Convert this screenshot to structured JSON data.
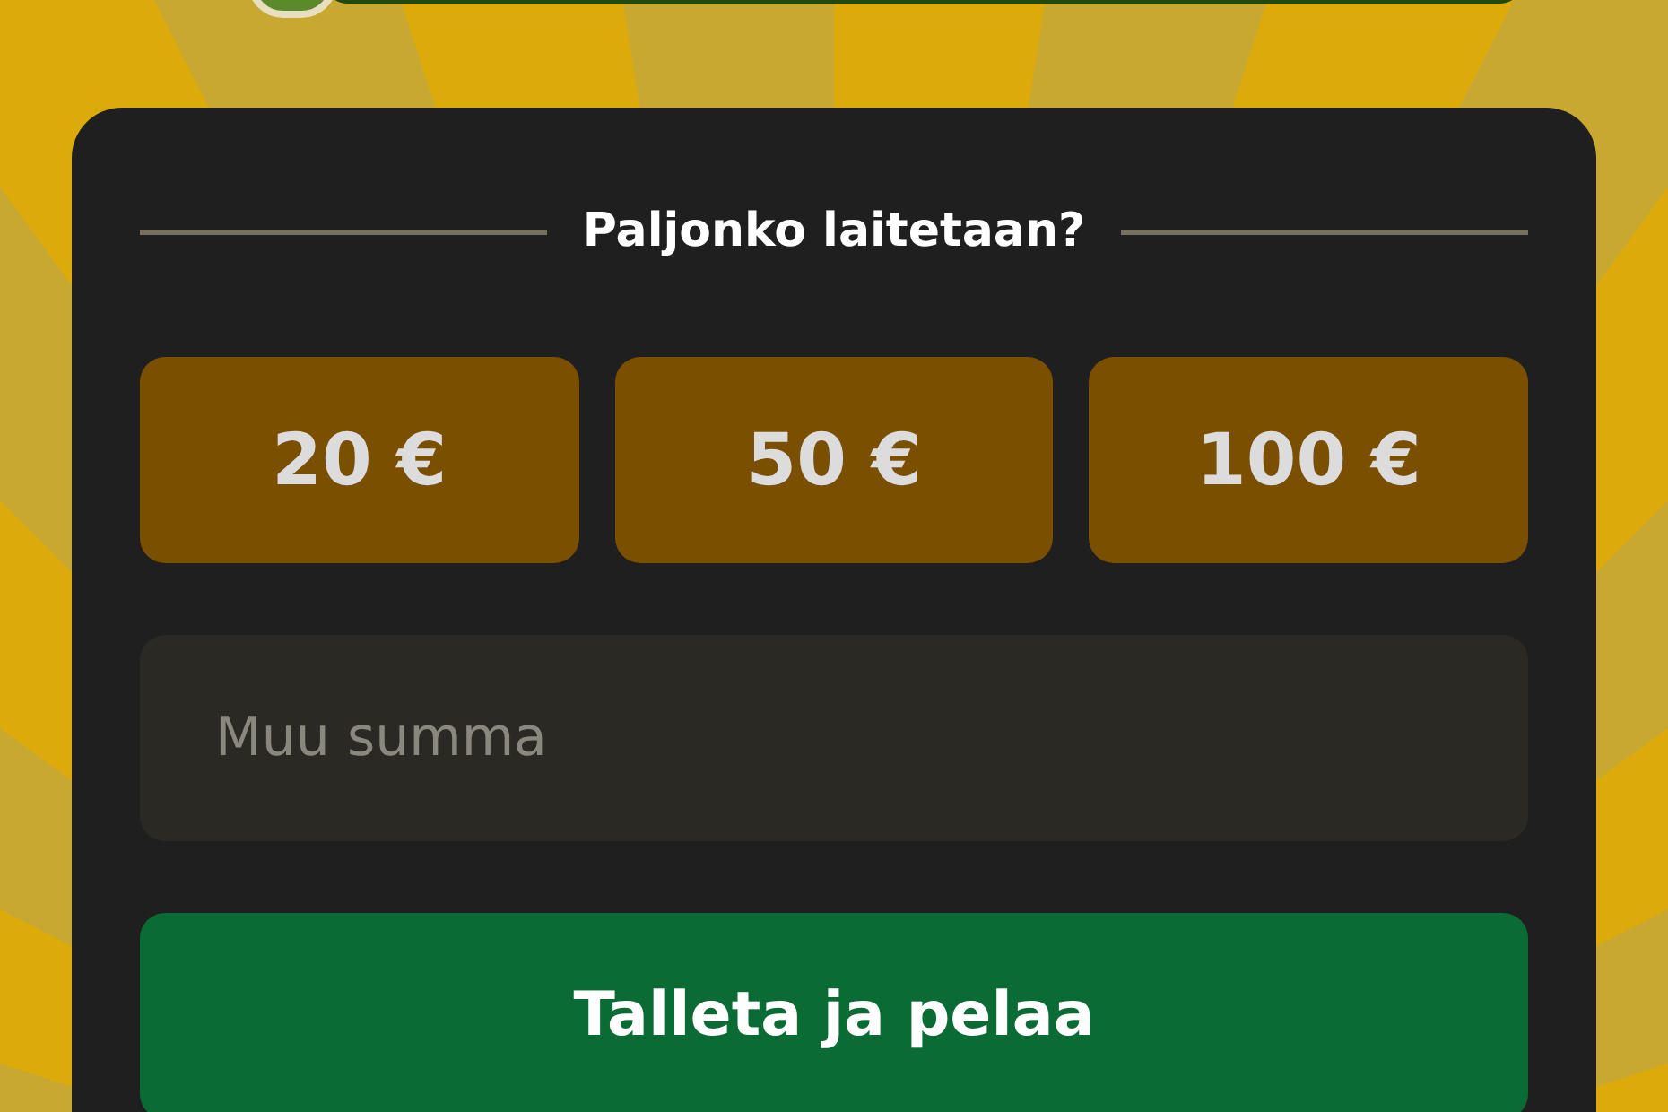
{
  "heading": "Paljonko laitetaan?",
  "amounts": [
    "20 €",
    "50 €",
    "100 €"
  ],
  "custom_amount": {
    "placeholder": "Muu summa"
  },
  "submit": "Talleta ja pelaa"
}
